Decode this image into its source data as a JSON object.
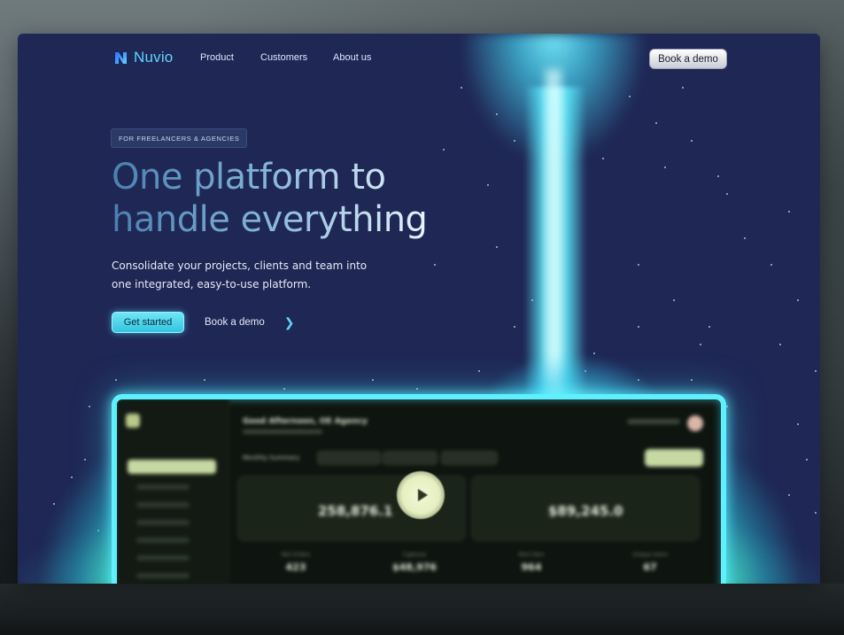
{
  "brand": {
    "name": "Nuvio",
    "accent": "#5fd4ff"
  },
  "nav": {
    "links": [
      "Product",
      "Customers",
      "About us"
    ],
    "cta_label": "Book a demo"
  },
  "hero": {
    "badge": "FOR FREELANCERS & AGENCIES",
    "headline_line1": "One platform to",
    "headline_line2": "handle everything",
    "subtitle": "Consolidate your projects, clients and team into one integrated, easy-to-use platform.",
    "primary_cta": "Get started",
    "secondary_cta": "Book a demo",
    "secondary_icon": "chevron-right-icon"
  },
  "dashboard_preview": {
    "greeting": "Good Afternoon, OE Agency",
    "section_label": "Monthly Summary",
    "card_values": [
      "258,876.1",
      "$89,245.0"
    ],
    "stats": [
      {
        "label": "Net Orders",
        "value": "423"
      },
      {
        "label": "Captures",
        "value": "$48,976"
      },
      {
        "label": "Rent Item",
        "value": "964"
      },
      {
        "label": "Unique Users",
        "value": "67"
      }
    ],
    "play_icon": "play-icon"
  },
  "colors": {
    "page_bg": "#1f2755",
    "beam": "#5ff0ff",
    "cta_bg": "#33c4e0"
  }
}
